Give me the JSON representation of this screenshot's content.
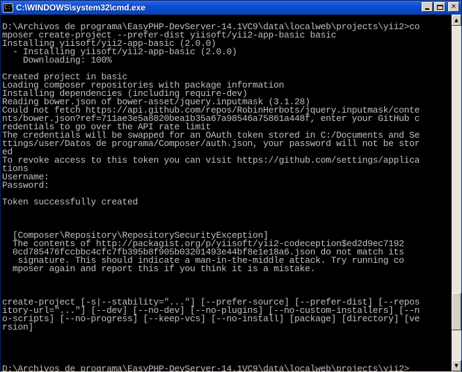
{
  "window": {
    "title": "C:\\WINDOWS\\system32\\cmd.exe",
    "icon": "cmd-icon",
    "icon_glyph": "C:\\"
  },
  "controls": {
    "minimize": "minimize-icon",
    "maximize": "maximize-icon",
    "close_glyph": "✕"
  },
  "scrollbar": {
    "up_glyph": "▲",
    "down_glyph": "▼",
    "position_fraction": 0.9
  },
  "console": {
    "lines": [
      "D:\\Archivos de programa\\EasyPHP-DevServer-14.1VC9\\data\\localweb\\projects\\yii2>co",
      "mposer create-project --prefer-dist yiisoft/yii2-app-basic basic",
      "Installing yiisoft/yii2-app-basic (2.0.0)",
      "  - Installing yiisoft/yii2-app-basic (2.0.0)",
      "    Downloading: 100%",
      "",
      "Created project in basic",
      "Loading composer repositories with package information",
      "Installing dependencies (including require-dev)",
      "Reading bower.json of bower-asset/jquery.inputmask (3.1.28)",
      "Could not fetch https://api.github.com/repos/RobinHerbots/jquery.inputmask/conte",
      "nts/bower.json?ref=711ae3e5a8820bea1b35a67a98546a75861a448f, enter your GitHub c",
      "redentials to go over the API rate limit",
      "The credentials will be swapped for an OAuth token stored in C:/Documents and Se",
      "ttings/user/Datos de programa/Composer/auth.json, your password will not be stor",
      "ed",
      "To revoke access to this token you can visit https://github.com/settings/applica",
      "tions",
      "Username:",
      "Password:",
      "",
      "Token successfully created",
      "",
      "",
      "",
      "  [Composer\\Repository\\RepositorySecurityException]",
      "  The contents of http://packagist.org/p/yiisoft/yii2-codeception$ed2d9ec7192",
      "  0cd785476fccbbc4cfc7fb395b8f905b03201493e44bf8e1e18a6.json do not match its",
      "   signature. This should indicate a man-in-the-middle attack. Try running co",
      "  mposer again and report this if you think it is a mistake.",
      "",
      "",
      "",
      "create-project [-s|--stability=\"...\"] [--prefer-source] [--prefer-dist] [--repos",
      "itory-url=\"...\"] [--dev] [--no-dev] [--no-plugins] [--no-custom-installers] [--n",
      "o-scripts] [--no-progress] [--keep-vcs] [--no-install] [package] [directory] [ve",
      "rsion]",
      "",
      "",
      "",
      "",
      "D:\\Archivos de programa\\EasyPHP-DevServer-14.1VC9\\data\\localweb\\projects\\yii2>"
    ]
  }
}
